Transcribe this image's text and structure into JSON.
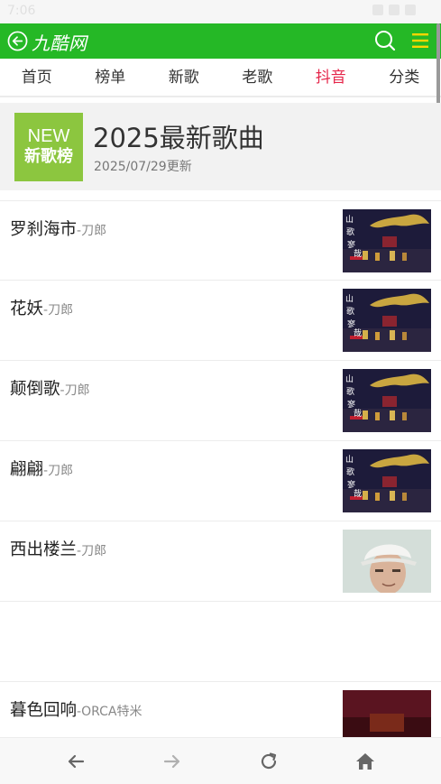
{
  "status": {
    "time": "7:06"
  },
  "header": {
    "logo": "九酷网",
    "bg_color": "#25b826"
  },
  "nav": {
    "tabs": [
      {
        "label": "首页",
        "active": false
      },
      {
        "label": "榜单",
        "active": false
      },
      {
        "label": "新歌",
        "active": false
      },
      {
        "label": "老歌",
        "active": false
      },
      {
        "label": "抖音",
        "active": true
      },
      {
        "label": "分类",
        "active": false
      }
    ],
    "active_color": "#e5264a"
  },
  "banner": {
    "badge_top": "NEW",
    "badge_bottom": "新歌榜",
    "badge_color": "#8cc63f",
    "title": "2025最新歌曲",
    "date": "2025/07/29更新"
  },
  "songs": [
    {
      "title": "罗刹海市",
      "artist": "-刀郎",
      "cover": "album-art"
    },
    {
      "title": "花妖",
      "artist": "-刀郎",
      "cover": "album-art"
    },
    {
      "title": "颠倒歌",
      "artist": "-刀郎",
      "cover": "album-art"
    },
    {
      "title": "翩翩",
      "artist": "-刀郎",
      "cover": "album-art"
    },
    {
      "title": "西出楼兰",
      "artist": "-刀郎",
      "cover": "portrait-photo"
    },
    {
      "title": "暮色回响",
      "artist": "-ORCA特米",
      "cover": "stage-photo"
    }
  ],
  "bottombar": {
    "icons": [
      "back-arrow-icon",
      "forward-arrow-icon",
      "reload-icon",
      "home-icon"
    ]
  }
}
